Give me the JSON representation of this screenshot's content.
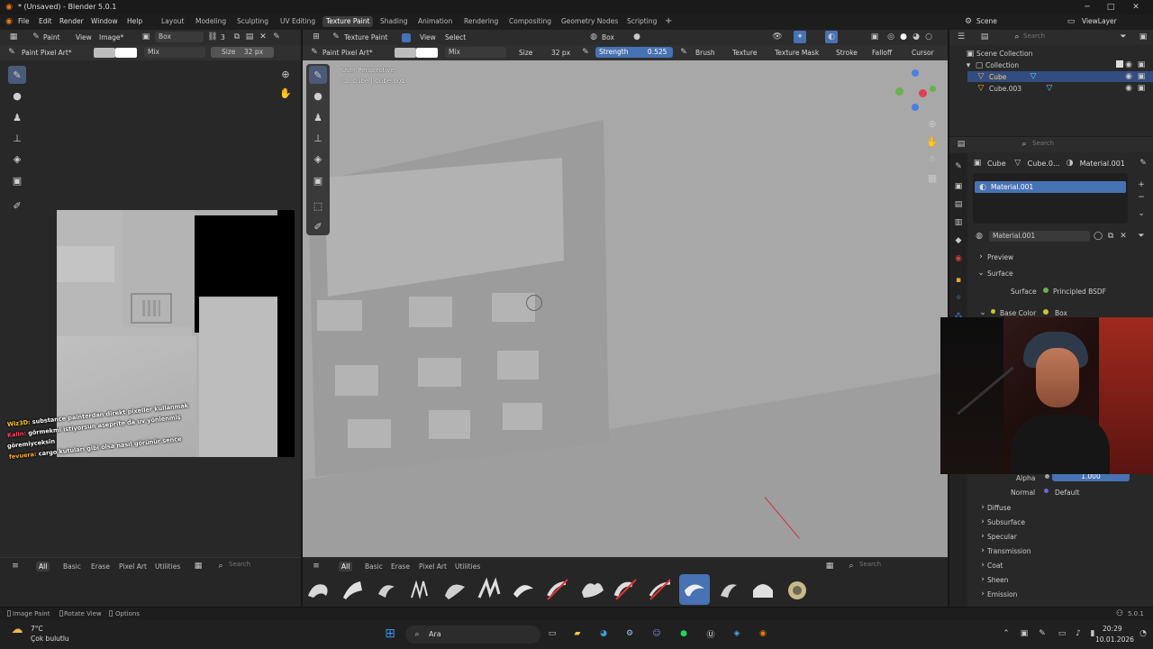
{
  "window": {
    "title": "* (Unsaved) - Blender 5.0.1"
  },
  "menu": [
    "File",
    "Edit",
    "Render",
    "Window",
    "Help"
  ],
  "workspaces": [
    "Layout",
    "Modeling",
    "Sculpting",
    "UV Editing",
    "Texture Paint",
    "Shading",
    "Animation",
    "Rendering",
    "Compositing",
    "Geometry Nodes",
    "Scripting"
  ],
  "scene": {
    "scene_label": "Scene",
    "viewlayer_label": "ViewLayer"
  },
  "image_editor": {
    "header": {
      "mode": "Paint",
      "view": "View",
      "image": "Image*",
      "box": "Box",
      "count": "3"
    },
    "toolhdr": {
      "brush": "Paint Pixel Art*",
      "blend": "Mix",
      "size_label": "Size",
      "size_value": "32 px"
    },
    "tabs": [
      "All",
      "Basic",
      "Erase",
      "Pixel Art",
      "Utilities"
    ],
    "search_placeholder": "Search"
  },
  "viewport": {
    "header": {
      "mode": "Texture Paint",
      "view": "View",
      "select": "Select",
      "box": "Box"
    },
    "toolhdr": {
      "brush": "Paint Pixel Art*",
      "blend": "Mix",
      "size_label": "Size",
      "size_value": "32 px",
      "strength_label": "Strength",
      "strength_value": "0.525",
      "brush_menu": "Brush",
      "texture": "Texture",
      "texture_mask": "Texture Mask",
      "stroke": "Stroke",
      "falloff": "Falloff",
      "cursor": "Cursor"
    },
    "overlay_info": {
      "line1": "User Perspective",
      "line2": "(1) Cube | Cube.001"
    },
    "tabs": [
      "All",
      "Basic",
      "Erase",
      "Pixel Art",
      "Utilities"
    ],
    "search_placeholder": "Search"
  },
  "outliner": {
    "search_placeholder": "Search",
    "scene_collection": "Scene Collection",
    "collection": "Collection",
    "items": [
      "Cube",
      "Cube.003"
    ]
  },
  "properties": {
    "search_placeholder": "Search",
    "breadcrumb": [
      "Cube",
      "Cube.0...",
      "Material.001"
    ],
    "slot": "Material.001",
    "material_name": "Material.001",
    "preview": "Preview",
    "surface": "Surface",
    "surface_label": "Surface",
    "surface_value": "Principled BSDF",
    "base_color_label": "Base Color",
    "base_color_value": "Box",
    "alpha_label": "Alpha",
    "alpha_value": "1.000",
    "normal_label": "Normal",
    "normal_value": "Default",
    "sections": [
      "Diffuse",
      "Subsurface",
      "Specular",
      "Transmission",
      "Coat",
      "Sheen",
      "Emission"
    ]
  },
  "chat": [
    {
      "user": "Wiz3D:",
      "msg": "substance painterdan direkt pixeller kullanmak"
    },
    {
      "user": "Kalin:",
      "msg": "görmekmi istiyorsun aseprite da uv yönlenmiş"
    },
    {
      "user": "",
      "msg": "göremiyceksin"
    },
    {
      "user": "fevuera:",
      "msg": "cargo kutuları gibi olsa nasıl görünür sence"
    }
  ],
  "statusbar": {
    "left1": "Image Paint",
    "left2": "Rotate View",
    "left3": "Options",
    "version": "5.0.1"
  },
  "taskbar": {
    "weather_temp": "7°C",
    "weather_desc": "Çok bulutlu",
    "search": "Ara",
    "time": "20:29",
    "date": "10.01.2026"
  },
  "colors": {
    "accent": "#4772b3",
    "header": "#2c2c2c",
    "viewport_bg": "#a8a8a8"
  }
}
